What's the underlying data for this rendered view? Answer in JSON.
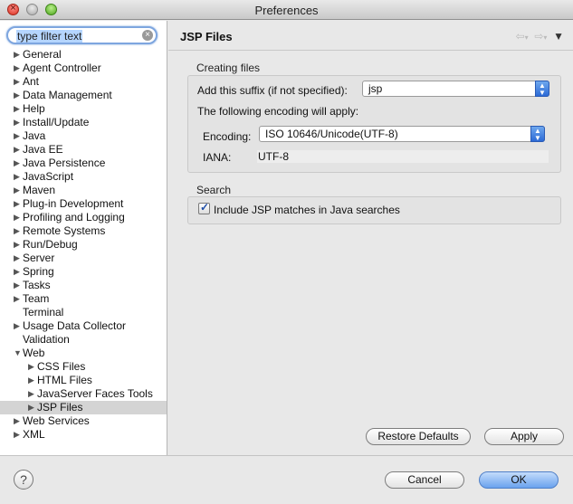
{
  "window": {
    "title": "Preferences"
  },
  "sidebar": {
    "filter": {
      "placeholder": "type filter text",
      "value": "type filter text"
    },
    "tree": [
      {
        "label": "General",
        "expandable": true,
        "level": 0
      },
      {
        "label": "Agent Controller",
        "expandable": true,
        "level": 0
      },
      {
        "label": "Ant",
        "expandable": true,
        "level": 0
      },
      {
        "label": "Data Management",
        "expandable": true,
        "level": 0
      },
      {
        "label": "Help",
        "expandable": true,
        "level": 0
      },
      {
        "label": "Install/Update",
        "expandable": true,
        "level": 0
      },
      {
        "label": "Java",
        "expandable": true,
        "level": 0
      },
      {
        "label": "Java EE",
        "expandable": true,
        "level": 0
      },
      {
        "label": "Java Persistence",
        "expandable": true,
        "level": 0
      },
      {
        "label": "JavaScript",
        "expandable": true,
        "level": 0
      },
      {
        "label": "Maven",
        "expandable": true,
        "level": 0
      },
      {
        "label": "Plug-in Development",
        "expandable": true,
        "level": 0
      },
      {
        "label": "Profiling and Logging",
        "expandable": true,
        "level": 0
      },
      {
        "label": "Remote Systems",
        "expandable": true,
        "level": 0
      },
      {
        "label": "Run/Debug",
        "expandable": true,
        "level": 0
      },
      {
        "label": "Server",
        "expandable": true,
        "level": 0
      },
      {
        "label": "Spring",
        "expandable": true,
        "level": 0
      },
      {
        "label": "Tasks",
        "expandable": true,
        "level": 0
      },
      {
        "label": "Team",
        "expandable": true,
        "level": 0
      },
      {
        "label": "Terminal",
        "expandable": false,
        "level": 0
      },
      {
        "label": "Usage Data Collector",
        "expandable": true,
        "level": 0
      },
      {
        "label": "Validation",
        "expandable": false,
        "level": 0
      },
      {
        "label": "Web",
        "expandable": true,
        "expanded": true,
        "level": 0
      },
      {
        "label": "CSS Files",
        "expandable": true,
        "level": 1
      },
      {
        "label": "HTML Files",
        "expandable": true,
        "level": 1
      },
      {
        "label": "JavaServer Faces Tools",
        "expandable": true,
        "level": 1
      },
      {
        "label": "JSP Files",
        "expandable": true,
        "level": 1,
        "selected": true
      },
      {
        "label": "Web Services",
        "expandable": true,
        "level": 0
      },
      {
        "label": "XML",
        "expandable": true,
        "level": 0
      }
    ]
  },
  "page": {
    "title": "JSP Files",
    "nav_icons": {
      "back": "back-arrow-icon",
      "forward": "forward-arrow-icon",
      "menu": "view-menu-icon"
    },
    "creating_files": {
      "group_label": "Creating files",
      "suffix_label": "Add this suffix (if not specified):",
      "suffix_value": "jsp",
      "encoding_note": "The following encoding will apply:",
      "encoding_label": "Encoding:",
      "encoding_value": "ISO 10646/Unicode(UTF-8)",
      "iana_label": "IANA:",
      "iana_value": "UTF-8"
    },
    "search": {
      "group_label": "Search",
      "include_label": "Include JSP matches in Java searches",
      "include_checked": true
    },
    "buttons": {
      "restore_defaults": "Restore Defaults",
      "apply": "Apply"
    }
  },
  "footer": {
    "help_icon": "help-question-icon",
    "help_glyph": "?",
    "cancel": "Cancel",
    "ok": "OK"
  },
  "colors": {
    "accent": "#3c7ee0",
    "selection": "#d4d4d4"
  }
}
